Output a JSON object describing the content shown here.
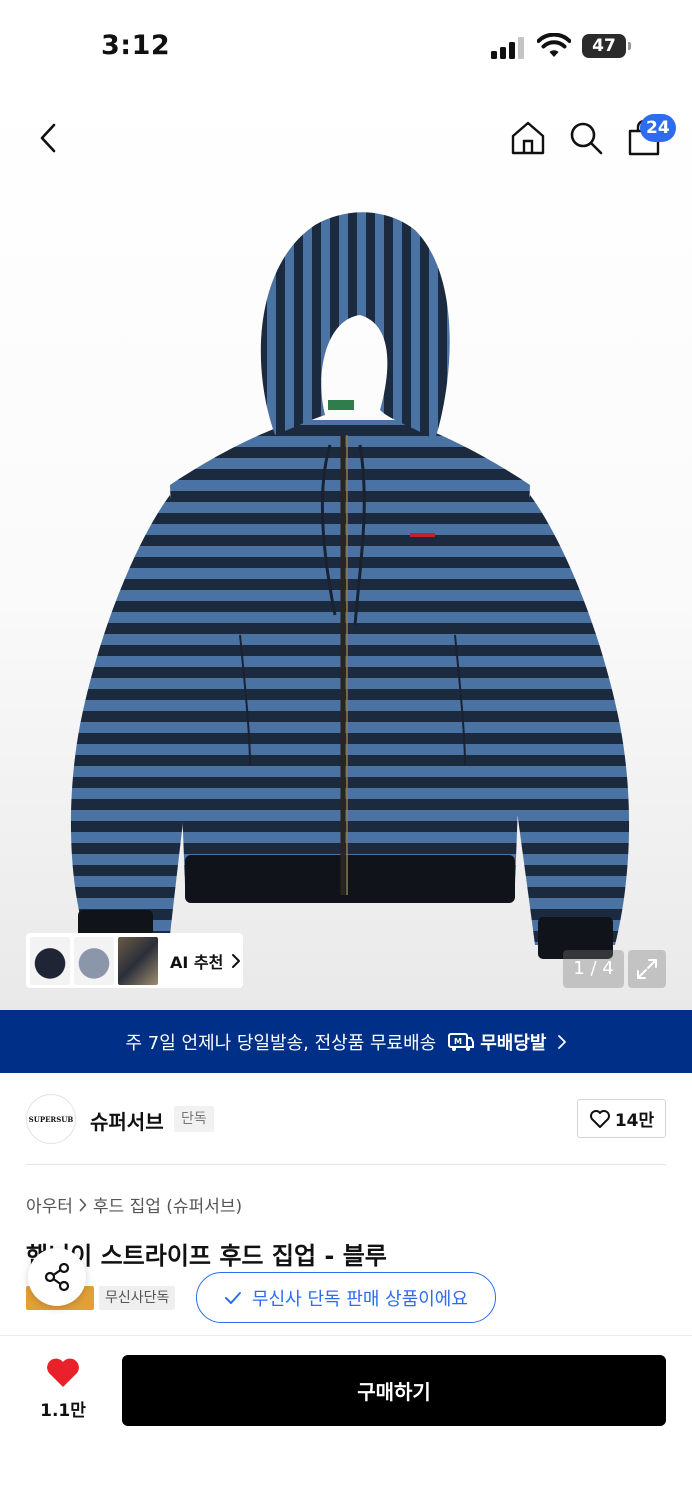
{
  "status_bar": {
    "time": "3:12",
    "battery": "47"
  },
  "header": {
    "cart_count": "24",
    "icons": [
      "chevron-left-icon",
      "home-icon",
      "search-icon",
      "shopping-bag-icon"
    ]
  },
  "gallery": {
    "ai_label": "AI 추천",
    "pager": "1 / 4"
  },
  "banner": {
    "text": "주 7일 언제나 당일발송, 전상품 무료배송",
    "logo_text": "무배당발",
    "color": "#002f87"
  },
  "brand": {
    "name": "슈퍼서브",
    "tag": "단독",
    "logo_text": "SUPERSUB",
    "likes": "14만"
  },
  "product": {
    "breadcrumb": [
      "아우터",
      "후드 집업 (슈퍼서브)"
    ],
    "title": "핸니이 스트라이프 후드 집업 - 블루",
    "badge_grey": "무신사단독",
    "exclusive_text": "무신사 단독 판매 상품이에요"
  },
  "bottom_bar": {
    "like_count": "1.1만",
    "buy_label": "구매하기"
  },
  "colors": {
    "accent_blue": "#2d6cf0",
    "badge_orange": "#e3a037",
    "heart_red": "#e8212a"
  }
}
